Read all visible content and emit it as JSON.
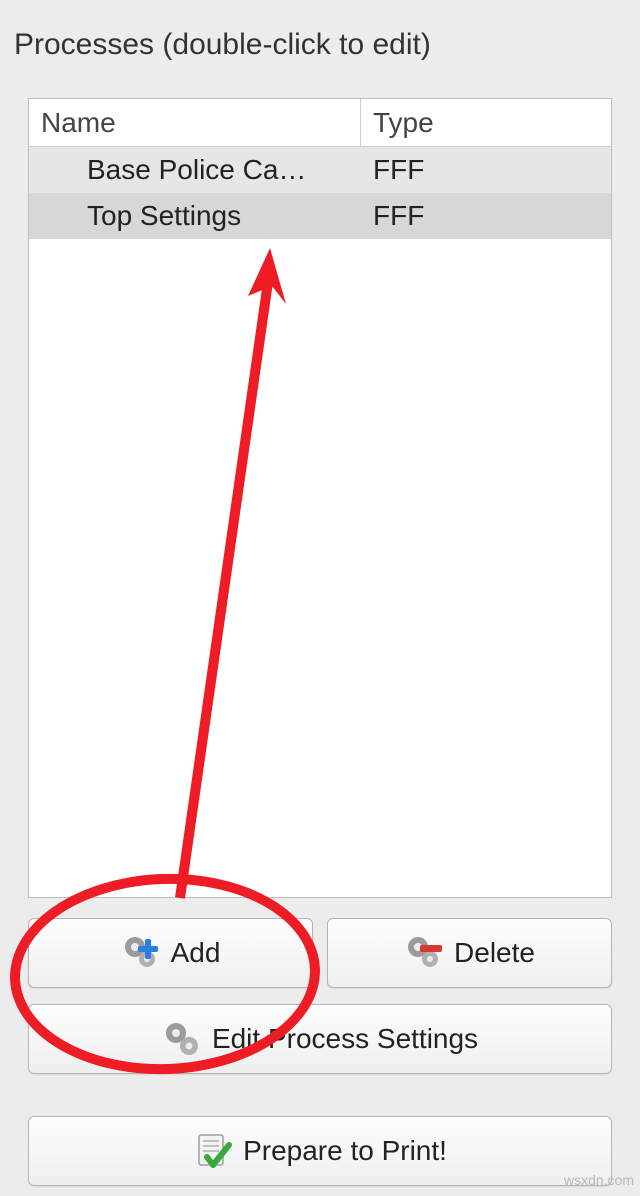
{
  "title": "Processes (double-click to edit)",
  "table": {
    "headers": {
      "name": "Name",
      "type": "Type"
    },
    "rows": [
      {
        "name": "Base Police Ca…",
        "type": "FFF"
      },
      {
        "name": "Top Settings",
        "type": "FFF"
      }
    ]
  },
  "buttons": {
    "add": "Add",
    "delete": "Delete",
    "edit": "Edit Process Settings",
    "prepare": "Prepare to Print!"
  },
  "watermark": "wsxdn.com"
}
